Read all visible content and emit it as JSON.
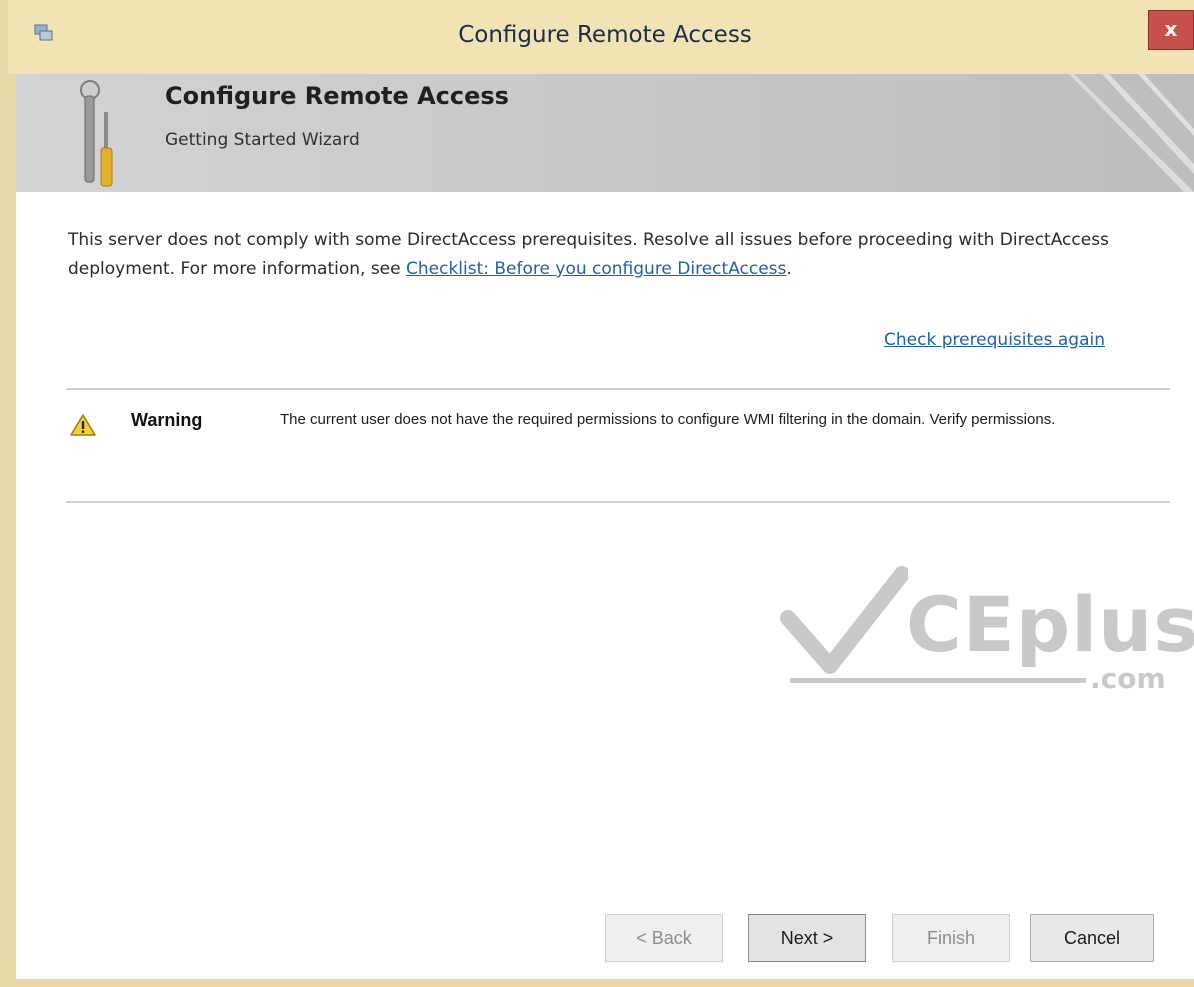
{
  "window": {
    "title": "Configure Remote Access",
    "close_label": "x"
  },
  "banner": {
    "title": "Configure Remote Access",
    "subtitle": "Getting Started Wizard"
  },
  "content": {
    "intro_text": "This server does not comply with some DirectAccess prerequisites. Resolve all issues before proceeding with DirectAccess deployment. For more information, see ",
    "intro_link": "Checklist: Before you configure DirectAccess",
    "intro_end": ".",
    "check_link": "Check prerequisites again",
    "issues": [
      {
        "severity": "Warning",
        "message": "The current user does not have the required permissions to configure WMI filtering in the domain. Verify permissions."
      }
    ]
  },
  "watermark": {
    "text": "CEplus",
    "suffix": ".com"
  },
  "buttons": {
    "back": "< Back",
    "next": "Next >",
    "finish": "Finish",
    "cancel": "Cancel"
  },
  "colors": {
    "titlebar": "#f2e3b4",
    "banner": "#c6c6c6",
    "link": "#1f5fb3",
    "close_button": "#c7504a",
    "warning_icon": "#f2d234"
  },
  "icons": {
    "window": "wizard-window-icon",
    "banner": "tools-icon",
    "warning": "warning-triangle-icon"
  }
}
